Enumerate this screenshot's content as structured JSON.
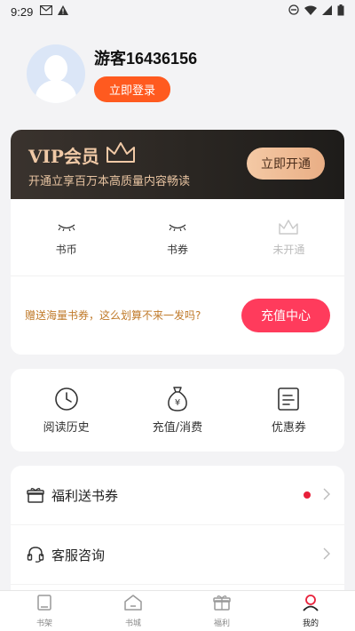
{
  "status_bar": {
    "time": "9:29"
  },
  "profile": {
    "username": "游客16436156",
    "login_label": "立即登录"
  },
  "vip": {
    "title": "VIP会员",
    "subtitle": "开通立享百万本高质量内容畅读",
    "open_label": "立即开通"
  },
  "assets": [
    {
      "label": "书币"
    },
    {
      "label": "书券"
    },
    {
      "label": "未开通"
    }
  ],
  "recharge": {
    "hint": "赠送海量书券，这么划算不来一发吗?",
    "button_label": "充值中心"
  },
  "actions": [
    {
      "label": "阅读历史",
      "icon": "clock-icon"
    },
    {
      "label": "充值/消费",
      "icon": "money-bag-icon"
    },
    {
      "label": "优惠券",
      "icon": "coupon-icon"
    }
  ],
  "list": [
    {
      "label": "福利送书券",
      "icon": "gift-icon",
      "has_dot": true
    },
    {
      "label": "客服咨询",
      "icon": "headset-icon",
      "has_dot": false
    }
  ],
  "tabbar": [
    {
      "label": "书架",
      "icon": "bookshelf-icon"
    },
    {
      "label": "书城",
      "icon": "bookstore-icon"
    },
    {
      "label": "福利",
      "icon": "gift-icon"
    },
    {
      "label": "我的",
      "icon": "profile-icon",
      "active": true
    }
  ],
  "colors": {
    "accent": "#ff5a1f",
    "recharge": "#ff3b5c",
    "vip_gold": "#f0c9a6",
    "dot": "#e8203a"
  }
}
